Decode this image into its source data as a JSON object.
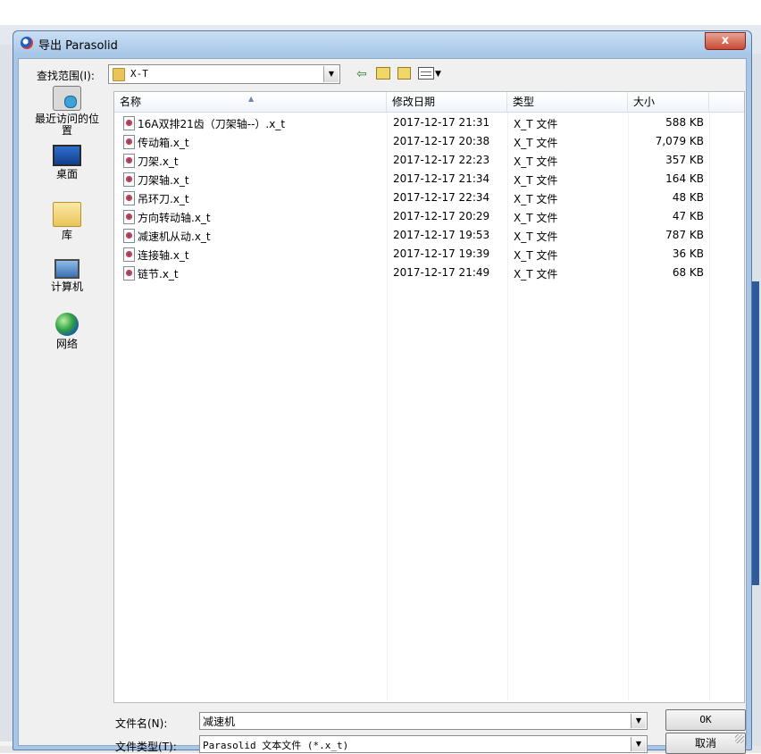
{
  "dialog": {
    "title": "导出 Parasolid",
    "close_label": "x"
  },
  "lookin": {
    "label": "查找范围(I):",
    "value": "X-T"
  },
  "toolbar": {
    "back_icon": "back-arrow-icon",
    "up_icon": "up-folder-icon",
    "new_folder_icon": "new-folder-icon",
    "view_menu_icon": "view-menu-icon"
  },
  "places": [
    {
      "label": "最近访问的位置",
      "icon": "recent-places-icon"
    },
    {
      "label": "桌面",
      "icon": "desktop-icon"
    },
    {
      "label": "库",
      "icon": "libraries-icon"
    },
    {
      "label": "计算机",
      "icon": "computer-icon"
    },
    {
      "label": "网络",
      "icon": "network-icon"
    }
  ],
  "columns": {
    "name": "名称",
    "date": "修改日期",
    "type": "类型",
    "size": "大小"
  },
  "files": [
    {
      "name": "16A双排21齿（刀架轴--）.x_t",
      "date": "2017-12-17 21:31",
      "type": "X_T 文件",
      "size": "588 KB"
    },
    {
      "name": "传动箱.x_t",
      "date": "2017-12-17 20:38",
      "type": "X_T 文件",
      "size": "7,079 KB"
    },
    {
      "name": "刀架.x_t",
      "date": "2017-12-17 22:23",
      "type": "X_T 文件",
      "size": "357 KB"
    },
    {
      "name": "刀架轴.x_t",
      "date": "2017-12-17 21:34",
      "type": "X_T 文件",
      "size": "164 KB"
    },
    {
      "name": "吊环刀.x_t",
      "date": "2017-12-17 22:34",
      "type": "X_T 文件",
      "size": "48 KB"
    },
    {
      "name": "方向转动轴.x_t",
      "date": "2017-12-17 20:29",
      "type": "X_T 文件",
      "size": "47 KB"
    },
    {
      "name": "减速机从动.x_t",
      "date": "2017-12-17 19:53",
      "type": "X_T 文件",
      "size": "787 KB"
    },
    {
      "name": "连接轴.x_t",
      "date": "2017-12-17 19:39",
      "type": "X_T 文件",
      "size": "36 KB"
    },
    {
      "name": "链节.x_t",
      "date": "2017-12-17 21:49",
      "type": "X_T 文件",
      "size": "68 KB"
    }
  ],
  "filename": {
    "label": "文件名(N):",
    "value": "减速机"
  },
  "filetype": {
    "label": "文件类型(T):",
    "value": "Parasolid 文本文件 (*.x_t)"
  },
  "buttons": {
    "ok": "OK",
    "cancel": "取消"
  }
}
